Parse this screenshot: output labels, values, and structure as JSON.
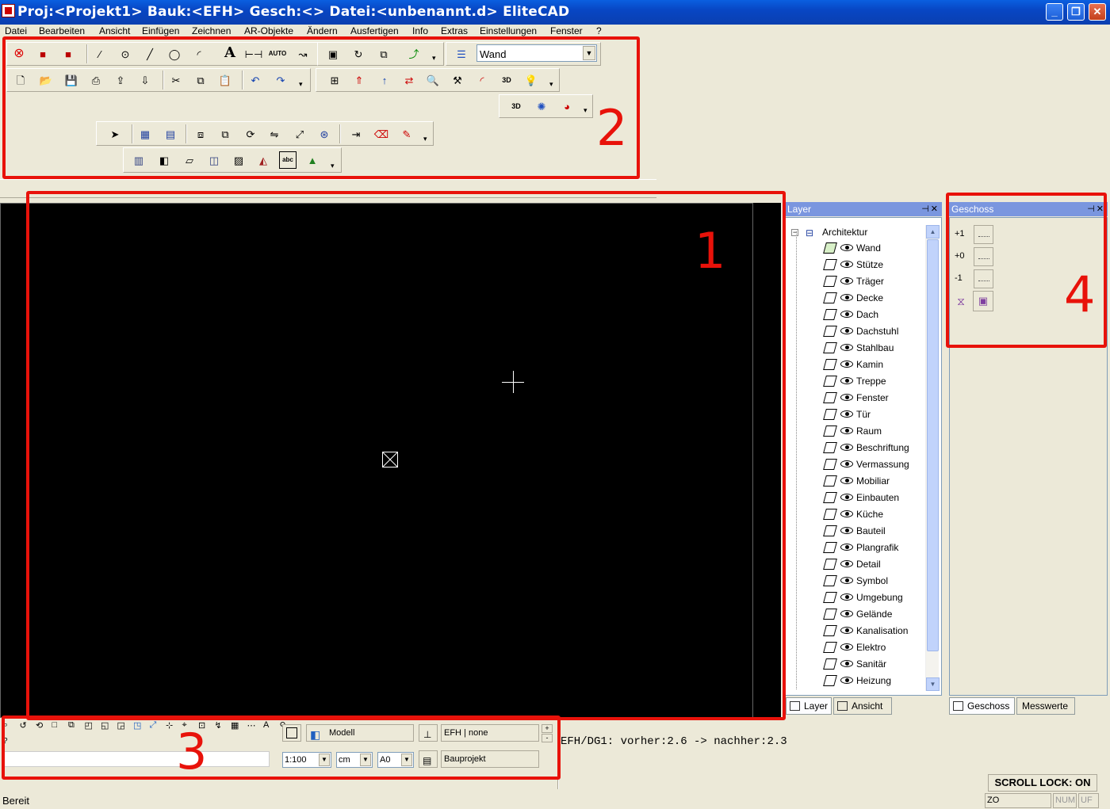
{
  "window": {
    "title": "Proj:<Projekt1> Bauk:<EFH>  Gesch:<>  Datei:<unbenannt.d> EliteCAD",
    "minimize": "_",
    "restore": "❐",
    "close": "✕"
  },
  "menu": [
    "Datei",
    "Bearbeiten",
    "Ansicht",
    "Einfügen",
    "Zeichnen",
    "AR-Objekte",
    "Ändern",
    "Ausfertigen",
    "Info",
    "Extras",
    "Einstellungen",
    "Fenster",
    "?"
  ],
  "toolbar": {
    "layer_combo": "Wand",
    "text_tool": "A",
    "auto_label": "AUTO",
    "threed_label": "3D",
    "abc_label": "abc"
  },
  "annotations": [
    "1",
    "2",
    "3",
    "4"
  ],
  "layer_panel": {
    "title": "Layer",
    "root": "Architektur",
    "items": [
      "Wand",
      "Stütze",
      "Träger",
      "Decke",
      "Dach",
      "Dachstuhl",
      "Stahlbau",
      "Kamin",
      "Treppe",
      "Fenster",
      "Tür",
      "Raum",
      "Beschriftung",
      "Vermassung",
      "Mobiliar",
      "Einbauten",
      "Küche",
      "Bauteil",
      "Plangrafik",
      "Detail",
      "Symbol",
      "Umgebung",
      "Gelände",
      "Kanalisation",
      "Elektro",
      "Sanitär",
      "Heizung"
    ],
    "tabs": [
      "Layer",
      "Ansicht"
    ]
  },
  "geschoss_panel": {
    "title": "Geschoss",
    "levels": [
      "+1",
      "+0",
      "-1"
    ],
    "tabs": [
      "Geschoss",
      "Messwerte"
    ]
  },
  "bottom": {
    "question": "?",
    "modell": "Modell",
    "efh": "EFH | none",
    "bauprojekt": "Bauprojekt",
    "scale": "1:100",
    "unit": "cm",
    "paper": "A0",
    "plus": "+",
    "minus": "-"
  },
  "message": "EFH/DG1: vorher:2.6 -> nachher:2.3",
  "status": {
    "left": "Bereit",
    "scroll_lock": "SCROLL LOCK: ON",
    "zo": "ZO",
    "num": "NUM",
    "uf": "UF"
  }
}
